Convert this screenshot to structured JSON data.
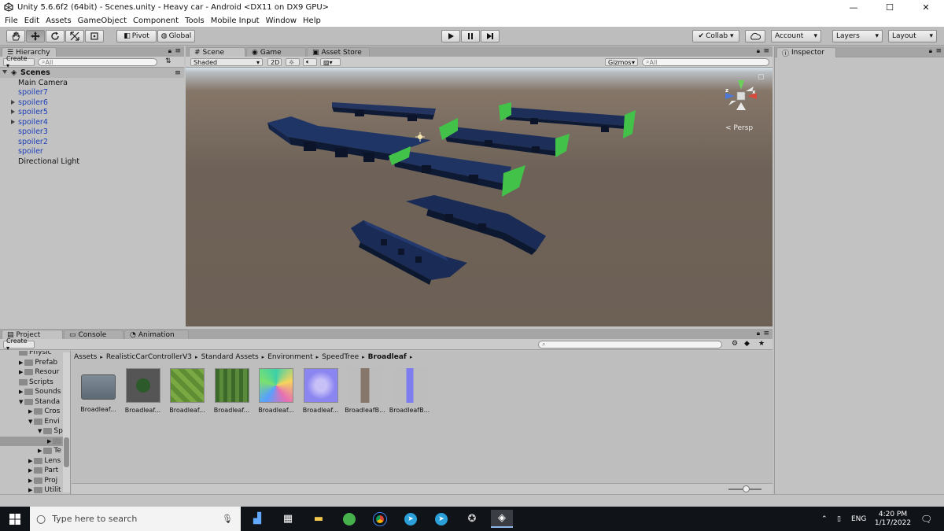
{
  "window": {
    "title": "Unity 5.6.6f2 (64bit) - Scenes.unity - Heavy car - Android <DX11 on DX9 GPU>",
    "minimize": "—",
    "maximize": "☐",
    "close": "✕"
  },
  "menu": [
    "File",
    "Edit",
    "Assets",
    "GameObject",
    "Component",
    "Tools",
    "Mobile Input",
    "Window",
    "Help"
  ],
  "toolbar": {
    "pivot": "Pivot",
    "global": "Global",
    "collab": "Collab ▾",
    "account": "Account",
    "layers": "Layers",
    "layout": "Layout"
  },
  "hierarchy": {
    "tab": "Hierarchy",
    "create": "Create ▾",
    "search_placeholder": "All",
    "scene": "Scenes",
    "items": [
      {
        "label": "Main Camera",
        "blue": false,
        "expandable": false
      },
      {
        "label": "spoiler7",
        "blue": true,
        "expandable": false
      },
      {
        "label": "spoiler6",
        "blue": true,
        "expandable": true
      },
      {
        "label": "spoiler5",
        "blue": true,
        "expandable": true
      },
      {
        "label": "spoiler4",
        "blue": true,
        "expandable": true
      },
      {
        "label": "spoiler3",
        "blue": true,
        "expandable": false
      },
      {
        "label": "spoiler2",
        "blue": true,
        "expandable": false
      },
      {
        "label": "spoiler",
        "blue": true,
        "expandable": false
      },
      {
        "label": "Directional Light",
        "blue": false,
        "expandable": false
      }
    ]
  },
  "scene": {
    "tabs": [
      "Scene",
      "Game",
      "Asset Store"
    ],
    "shading": "Shaded",
    "mode2d": "2D",
    "gizmos": "Gizmos",
    "search_placeholder": "All",
    "persp": "< Persp",
    "axis_x": "x",
    "axis_z": "z"
  },
  "project": {
    "tabs": [
      "Project",
      "Console",
      "Animation"
    ],
    "create": "Create ▾",
    "tree": [
      {
        "label": "Physic",
        "indent": 2,
        "arrow": false
      },
      {
        "label": "Prefab",
        "indent": 2,
        "arrow": true
      },
      {
        "label": "Resour",
        "indent": 2,
        "arrow": true
      },
      {
        "label": "Scripts",
        "indent": 2,
        "arrow": false
      },
      {
        "label": "Sounds",
        "indent": 2,
        "arrow": true
      },
      {
        "label": "Standa",
        "indent": 2,
        "arrow": true,
        "open": true
      },
      {
        "label": "Cros",
        "indent": 3,
        "arrow": true
      },
      {
        "label": "Envi",
        "indent": 3,
        "arrow": true,
        "open": true
      },
      {
        "label": "Sp",
        "indent": 4,
        "arrow": true,
        "open": true
      },
      {
        "label": "",
        "indent": 5,
        "arrow": true,
        "selected": true
      },
      {
        "label": "Te",
        "indent": 4,
        "arrow": true
      },
      {
        "label": "Lens",
        "indent": 3,
        "arrow": true
      },
      {
        "label": "Part",
        "indent": 3,
        "arrow": true
      },
      {
        "label": "Proj",
        "indent": 3,
        "arrow": true
      },
      {
        "label": "Utilit",
        "indent": 3,
        "arrow": true
      }
    ],
    "breadcrumb": [
      "Assets",
      "RealisticCarControllerV3",
      "Standard Assets",
      "Environment",
      "SpeedTree",
      "Broadleaf"
    ],
    "assets": [
      {
        "label": "Broadleaf...",
        "kind": "folder"
      },
      {
        "label": "Broadleaf...",
        "kind": "tree-prefab"
      },
      {
        "label": "Broadleaf...",
        "kind": "leaf-green"
      },
      {
        "label": "Broadleaf...",
        "kind": "leaf-pattern"
      },
      {
        "label": "Broadleaf...",
        "kind": "leaf-colorful"
      },
      {
        "label": "Broadleaf...",
        "kind": "leaf-normal"
      },
      {
        "label": "BroadleafB...",
        "kind": "bark"
      },
      {
        "label": "BroadleafB...",
        "kind": "bark-normal"
      }
    ]
  },
  "inspector": {
    "tab": "Inspector"
  },
  "taskbar": {
    "search_placeholder": "Type here to search",
    "lang": "ENG",
    "time": "4:20 PM",
    "date": "1/17/2022"
  }
}
